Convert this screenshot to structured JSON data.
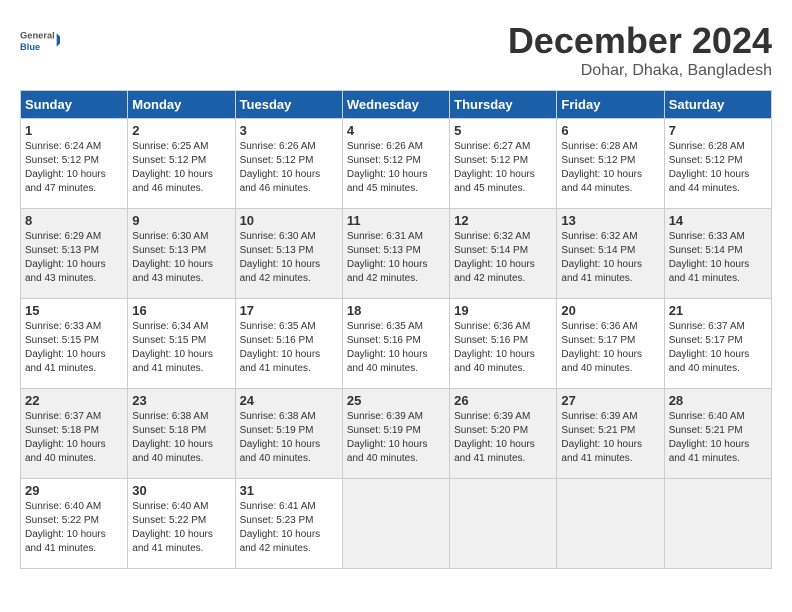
{
  "header": {
    "logo_general": "General",
    "logo_blue": "Blue",
    "month_title": "December 2024",
    "location": "Dohar, Dhaka, Bangladesh"
  },
  "weekdays": [
    "Sunday",
    "Monday",
    "Tuesday",
    "Wednesday",
    "Thursday",
    "Friday",
    "Saturday"
  ],
  "weeks": [
    [
      {
        "day": "1",
        "sunrise": "6:24 AM",
        "sunset": "5:12 PM",
        "daylight": "10 hours and 47 minutes."
      },
      {
        "day": "2",
        "sunrise": "6:25 AM",
        "sunset": "5:12 PM",
        "daylight": "10 hours and 46 minutes."
      },
      {
        "day": "3",
        "sunrise": "6:26 AM",
        "sunset": "5:12 PM",
        "daylight": "10 hours and 46 minutes."
      },
      {
        "day": "4",
        "sunrise": "6:26 AM",
        "sunset": "5:12 PM",
        "daylight": "10 hours and 45 minutes."
      },
      {
        "day": "5",
        "sunrise": "6:27 AM",
        "sunset": "5:12 PM",
        "daylight": "10 hours and 45 minutes."
      },
      {
        "day": "6",
        "sunrise": "6:28 AM",
        "sunset": "5:12 PM",
        "daylight": "10 hours and 44 minutes."
      },
      {
        "day": "7",
        "sunrise": "6:28 AM",
        "sunset": "5:12 PM",
        "daylight": "10 hours and 44 minutes."
      }
    ],
    [
      {
        "day": "8",
        "sunrise": "6:29 AM",
        "sunset": "5:13 PM",
        "daylight": "10 hours and 43 minutes."
      },
      {
        "day": "9",
        "sunrise": "6:30 AM",
        "sunset": "5:13 PM",
        "daylight": "10 hours and 43 minutes."
      },
      {
        "day": "10",
        "sunrise": "6:30 AM",
        "sunset": "5:13 PM",
        "daylight": "10 hours and 42 minutes."
      },
      {
        "day": "11",
        "sunrise": "6:31 AM",
        "sunset": "5:13 PM",
        "daylight": "10 hours and 42 minutes."
      },
      {
        "day": "12",
        "sunrise": "6:32 AM",
        "sunset": "5:14 PM",
        "daylight": "10 hours and 42 minutes."
      },
      {
        "day": "13",
        "sunrise": "6:32 AM",
        "sunset": "5:14 PM",
        "daylight": "10 hours and 41 minutes."
      },
      {
        "day": "14",
        "sunrise": "6:33 AM",
        "sunset": "5:14 PM",
        "daylight": "10 hours and 41 minutes."
      }
    ],
    [
      {
        "day": "15",
        "sunrise": "6:33 AM",
        "sunset": "5:15 PM",
        "daylight": "10 hours and 41 minutes."
      },
      {
        "day": "16",
        "sunrise": "6:34 AM",
        "sunset": "5:15 PM",
        "daylight": "10 hours and 41 minutes."
      },
      {
        "day": "17",
        "sunrise": "6:35 AM",
        "sunset": "5:16 PM",
        "daylight": "10 hours and 41 minutes."
      },
      {
        "day": "18",
        "sunrise": "6:35 AM",
        "sunset": "5:16 PM",
        "daylight": "10 hours and 40 minutes."
      },
      {
        "day": "19",
        "sunrise": "6:36 AM",
        "sunset": "5:16 PM",
        "daylight": "10 hours and 40 minutes."
      },
      {
        "day": "20",
        "sunrise": "6:36 AM",
        "sunset": "5:17 PM",
        "daylight": "10 hours and 40 minutes."
      },
      {
        "day": "21",
        "sunrise": "6:37 AM",
        "sunset": "5:17 PM",
        "daylight": "10 hours and 40 minutes."
      }
    ],
    [
      {
        "day": "22",
        "sunrise": "6:37 AM",
        "sunset": "5:18 PM",
        "daylight": "10 hours and 40 minutes."
      },
      {
        "day": "23",
        "sunrise": "6:38 AM",
        "sunset": "5:18 PM",
        "daylight": "10 hours and 40 minutes."
      },
      {
        "day": "24",
        "sunrise": "6:38 AM",
        "sunset": "5:19 PM",
        "daylight": "10 hours and 40 minutes."
      },
      {
        "day": "25",
        "sunrise": "6:39 AM",
        "sunset": "5:19 PM",
        "daylight": "10 hours and 40 minutes."
      },
      {
        "day": "26",
        "sunrise": "6:39 AM",
        "sunset": "5:20 PM",
        "daylight": "10 hours and 41 minutes."
      },
      {
        "day": "27",
        "sunrise": "6:39 AM",
        "sunset": "5:21 PM",
        "daylight": "10 hours and 41 minutes."
      },
      {
        "day": "28",
        "sunrise": "6:40 AM",
        "sunset": "5:21 PM",
        "daylight": "10 hours and 41 minutes."
      }
    ],
    [
      {
        "day": "29",
        "sunrise": "6:40 AM",
        "sunset": "5:22 PM",
        "daylight": "10 hours and 41 minutes."
      },
      {
        "day": "30",
        "sunrise": "6:40 AM",
        "sunset": "5:22 PM",
        "daylight": "10 hours and 41 minutes."
      },
      {
        "day": "31",
        "sunrise": "6:41 AM",
        "sunset": "5:23 PM",
        "daylight": "10 hours and 42 minutes."
      },
      null,
      null,
      null,
      null
    ]
  ]
}
